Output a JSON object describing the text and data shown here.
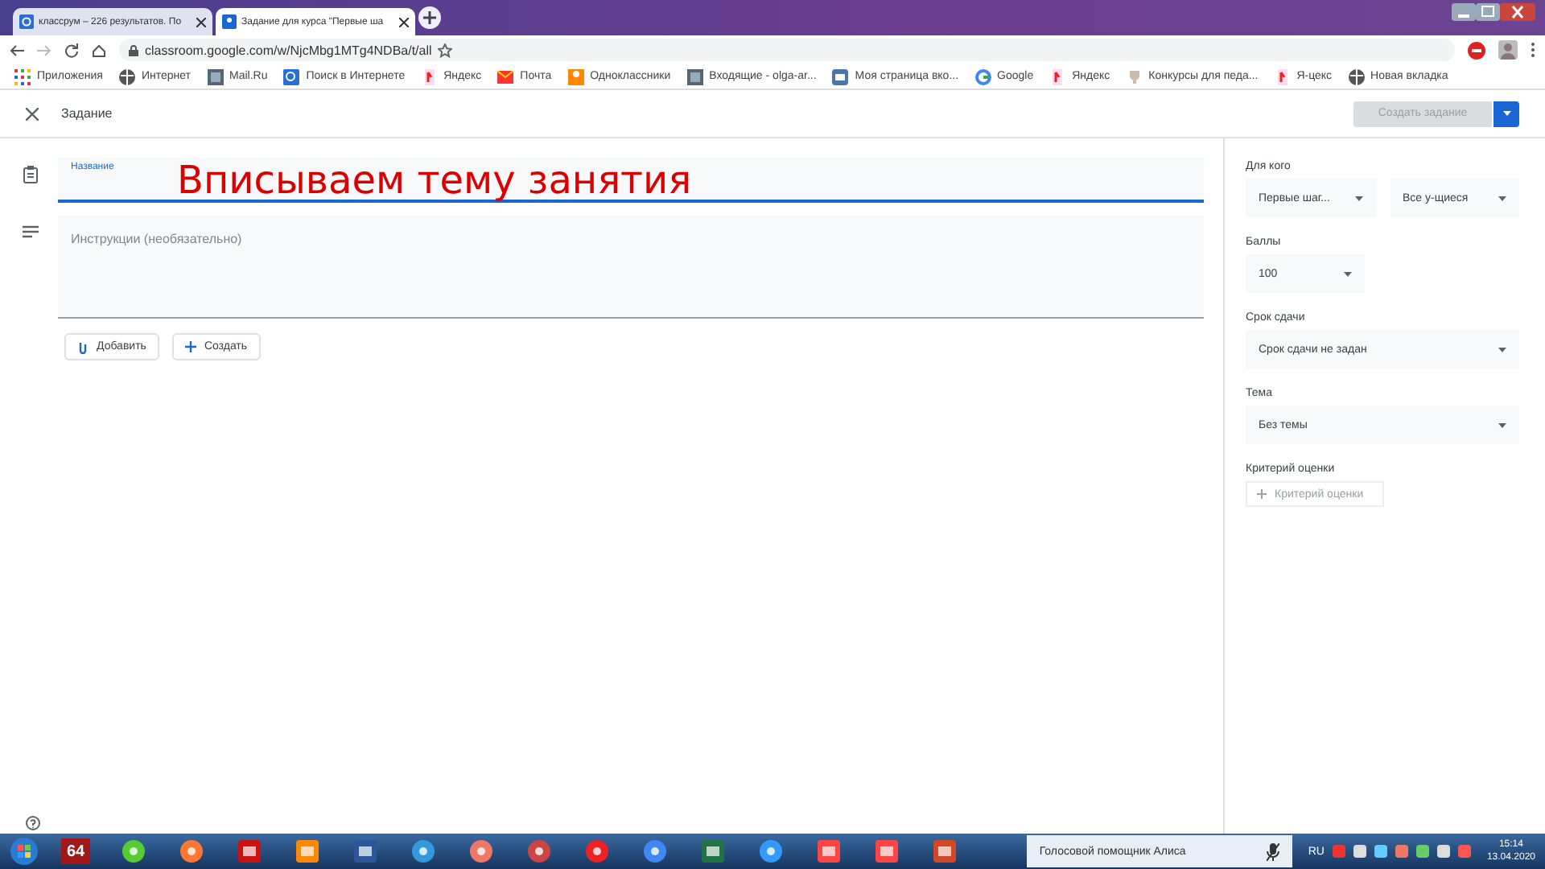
{
  "browser": {
    "tabs": [
      {
        "title": "классрум – 226 результатов. По",
        "selected": false
      },
      {
        "title": "Задание для курса \"Первые ша",
        "selected": true
      }
    ],
    "address": "classroom.google.com/w/NjcMbg1MTg4NDBa/t/all",
    "bookmarks": [
      {
        "label": "Приложения",
        "kind": "apps"
      },
      {
        "label": "Интернет",
        "kind": "globe"
      },
      {
        "label": "Mail.Ru",
        "kind": "site"
      },
      {
        "label": "Поиск в Интернете",
        "kind": "search"
      },
      {
        "label": "Яндекс",
        "kind": "yandex"
      },
      {
        "label": "Почта",
        "kind": "mail"
      },
      {
        "label": "Одноклассники",
        "kind": "ok"
      },
      {
        "label": "Входящие - olga-ar...",
        "kind": "site"
      },
      {
        "label": "Моя страница вко...",
        "kind": "vk"
      },
      {
        "label": "Google",
        "kind": "google"
      },
      {
        "label": "Яндекс",
        "kind": "yandex"
      },
      {
        "label": "Конкурсы для педа...",
        "kind": "trophy"
      },
      {
        "label": "Я-цекс",
        "kind": "yandex"
      },
      {
        "label": "Новая вкладка",
        "kind": "globe"
      }
    ]
  },
  "page": {
    "title": "Задание",
    "primary_button": {
      "label": "Создать задание",
      "disabled": true
    },
    "title_field": {
      "label": "Название",
      "focused": true
    },
    "instructions_field": {
      "placeholder": "Инструкции (необязательно)"
    },
    "actions": [
      {
        "label": "Добавить",
        "kind": "attach"
      },
      {
        "label": "Создать",
        "kind": "create"
      }
    ]
  },
  "annotation": "Вписываем тему занятия",
  "settings": {
    "for_whom": {
      "label": "Для кого",
      "course": "Первые шаг...",
      "students": "Все у-щиеся"
    },
    "points": {
      "label": "Баллы",
      "value": "100"
    },
    "due": {
      "label": "Срок сдачи",
      "value": "Срок сдачи не задан"
    },
    "topic": {
      "label": "Тема",
      "value": "Без темы"
    },
    "rubric": {
      "label": "Критерий оценки",
      "button": "Критерий оценки"
    }
  },
  "taskbar": {
    "apps": [
      {
        "kind": "aida",
        "label": "64"
      },
      {
        "kind": "android"
      },
      {
        "kind": "firefox"
      },
      {
        "kind": "acrobat"
      },
      {
        "kind": "speed"
      },
      {
        "kind": "word"
      },
      {
        "kind": "sound"
      },
      {
        "kind": "paint"
      },
      {
        "kind": "game"
      },
      {
        "kind": "yabrowser"
      },
      {
        "kind": "chrome"
      },
      {
        "kind": "excel"
      },
      {
        "kind": "bolt"
      },
      {
        "kind": "yandex"
      },
      {
        "kind": "yandex"
      },
      {
        "kind": "powerpoint"
      }
    ],
    "assistant": "Голосовой помощник Алиса",
    "language": "RU",
    "time": "15:14",
    "date": "13.04.2020"
  }
}
